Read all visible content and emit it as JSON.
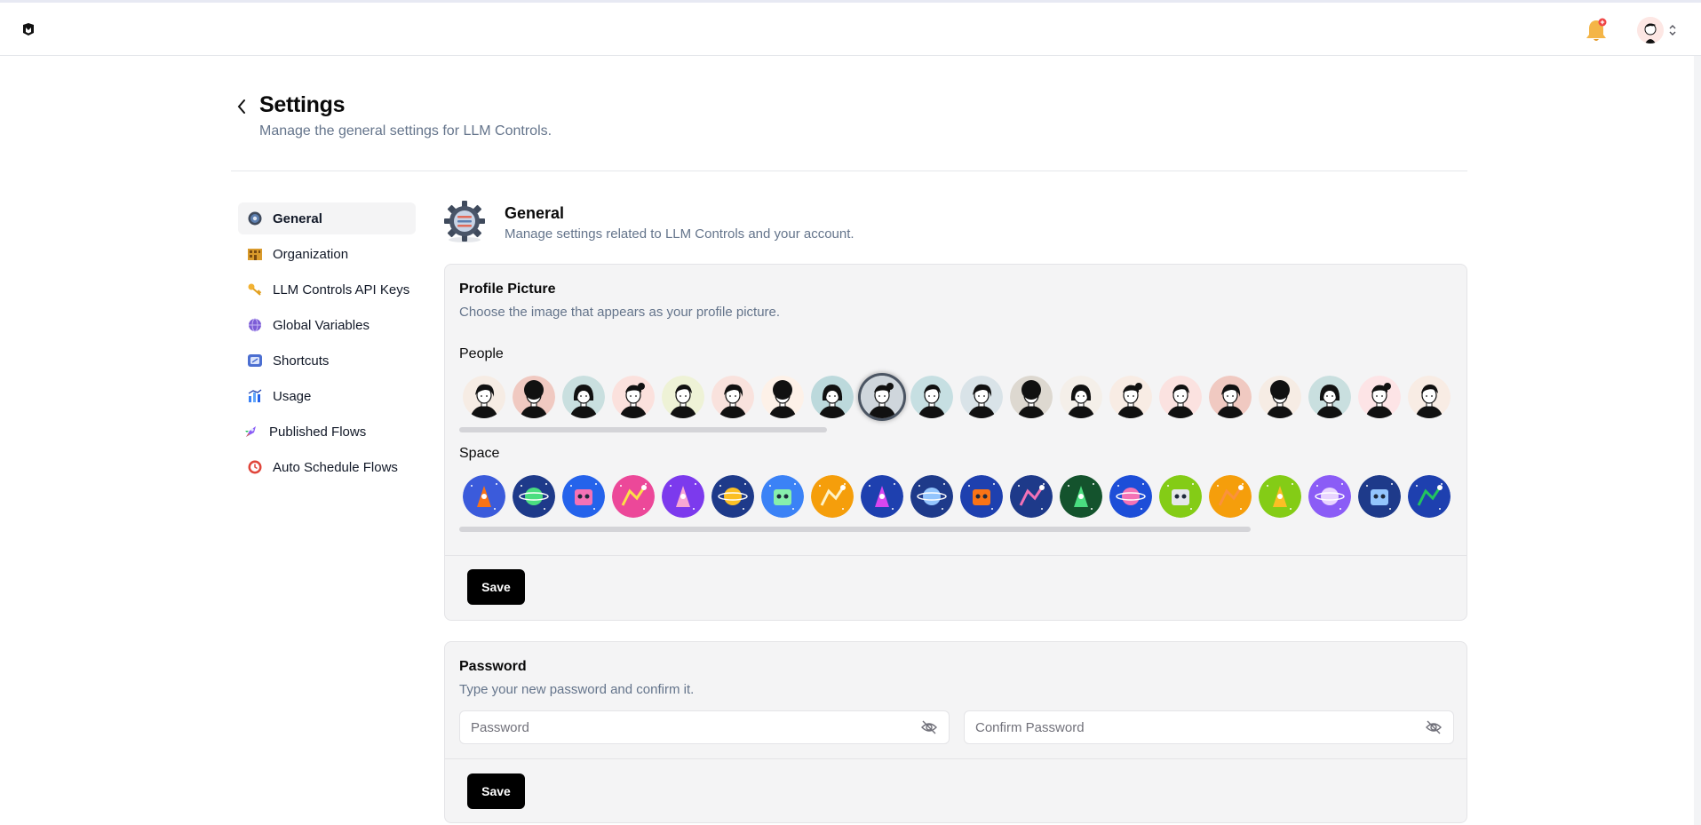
{
  "header": {
    "title": "Settings",
    "subtitle": "Manage the general settings for LLM Controls."
  },
  "sidebar": {
    "items": [
      {
        "label": "General",
        "icon": "gear-icon",
        "active": true
      },
      {
        "label": "Organization",
        "icon": "building-icon",
        "active": false
      },
      {
        "label": "LLM Controls API Keys",
        "icon": "key-icon",
        "active": false
      },
      {
        "label": "Global Variables",
        "icon": "globe-icon",
        "active": false
      },
      {
        "label": "Shortcuts",
        "icon": "keyboard-icon",
        "active": false
      },
      {
        "label": "Usage",
        "icon": "bar-chart-icon",
        "active": false
      },
      {
        "label": "Published Flows",
        "icon": "rocket-icon",
        "active": false
      },
      {
        "label": "Auto Schedule Flows",
        "icon": "clock-icon",
        "active": false
      }
    ]
  },
  "general": {
    "title": "General",
    "subtitle": "Manage settings related to LLM Controls and your account."
  },
  "profile_picture": {
    "title": "Profile Picture",
    "description": "Choose the image that appears as your profile picture.",
    "people_label": "People",
    "space_label": "Space",
    "people_count": 20,
    "space_count": 20,
    "selected_people_index": 8,
    "save_label": "Save"
  },
  "password": {
    "title": "Password",
    "description": "Type your new password and confirm it.",
    "password_placeholder": "Password",
    "confirm_placeholder": "Confirm Password",
    "save_label": "Save"
  },
  "colors": {
    "accent": "#000000",
    "muted_text": "#64748b",
    "card_bg": "#f4f4f5"
  }
}
